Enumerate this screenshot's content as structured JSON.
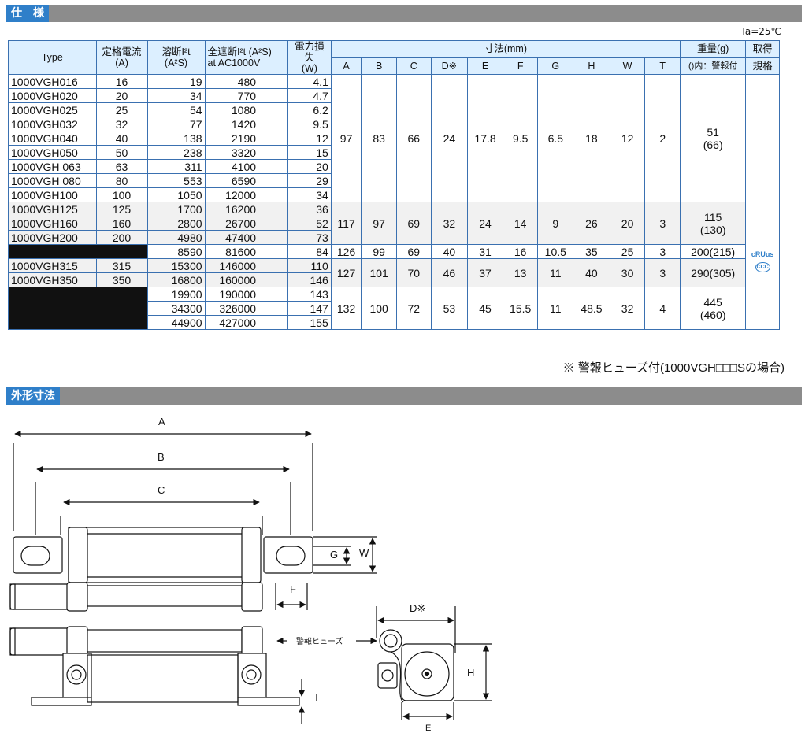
{
  "section1": {
    "title": "仕　様"
  },
  "ta": "Ta=25℃",
  "headers": {
    "type": "Type",
    "rated_current": "定格電流",
    "rated_current_unit": "(A)",
    "melting_i2t": "溶断I²t",
    "melting_i2t_unit": "(A²S)",
    "clearing_i2t": "全遮断I²t (A²S)",
    "clearing_i2t_sub": "at AC1000V",
    "power_loss": "電力損失",
    "power_loss_unit": "(W)",
    "dimensions": "寸法(mm)",
    "dims": [
      "A",
      "B",
      "C",
      "D※",
      "E",
      "F",
      "G",
      "H",
      "W",
      "T"
    ],
    "weight": "重量(g)",
    "weight_sub": "()内：警報付",
    "cert": "取得",
    "cert_sub": "規格"
  },
  "rows": [
    [
      "1000VGH016",
      "16",
      "19",
      "480",
      "4.1"
    ],
    [
      "1000VGH020",
      "20",
      "34",
      "770",
      "4.7"
    ],
    [
      "1000VGH025",
      "25",
      "54",
      "1080",
      "6.2"
    ],
    [
      "1000VGH032",
      "32",
      "77",
      "1420",
      "9.5"
    ],
    [
      "1000VGH040",
      "40",
      "138",
      "2190",
      "12"
    ],
    [
      "1000VGH050",
      "50",
      "238",
      "3320",
      "15"
    ],
    [
      "1000VGH 063",
      "63",
      "311",
      "4100",
      "20"
    ],
    [
      "1000VGH 080",
      "80",
      "553",
      "6590",
      "29"
    ],
    [
      "1000VGH100",
      "100",
      "1050",
      "12000",
      "34"
    ],
    [
      "1000VGH125",
      "125",
      "1700",
      "16200",
      "36"
    ],
    [
      "1000VGH160",
      "160",
      "2800",
      "26700",
      "52"
    ],
    [
      "1000VGH200",
      "200",
      "4980",
      "47400",
      "73"
    ],
    [
      "",
      "",
      "8590",
      "81600",
      "84"
    ],
    [
      "1000VGH315",
      "315",
      "15300",
      "146000",
      "110"
    ],
    [
      "1000VGH350",
      "350",
      "16800",
      "160000",
      "146"
    ],
    [
      "",
      "",
      "19900",
      "190000",
      "143"
    ],
    [
      "",
      "",
      "34300",
      "326000",
      "147"
    ],
    [
      "",
      "",
      "44900",
      "427000",
      "155"
    ]
  ],
  "dim_groups": [
    {
      "dims": [
        "97",
        "83",
        "66",
        "24",
        "17.8",
        "9.5",
        "6.5",
        "18",
        "12",
        "2"
      ],
      "weight": "51",
      "weight_alarm": "(66)"
    },
    {
      "dims": [
        "117",
        "97",
        "69",
        "32",
        "24",
        "14",
        "9",
        "26",
        "20",
        "3"
      ],
      "weight": "115",
      "weight_alarm": "(130)"
    },
    {
      "dims": [
        "126",
        "99",
        "69",
        "40",
        "31",
        "16",
        "10.5",
        "35",
        "25",
        "3"
      ],
      "weight": "200(215)",
      "weight_alarm": ""
    },
    {
      "dims": [
        "127",
        "101",
        "70",
        "46",
        "37",
        "13",
        "11",
        "40",
        "30",
        "3"
      ],
      "weight": "290(305)",
      "weight_alarm": ""
    },
    {
      "dims": [
        "132",
        "100",
        "72",
        "53",
        "45",
        "15.5",
        "11",
        "48.5",
        "32",
        "4"
      ],
      "weight": "445",
      "weight_alarm": "(460)"
    }
  ],
  "cert_marks": {
    "ul": "cRUus",
    "ccc": "CCC"
  },
  "footnote": "※ 警報ヒューズ付(1000VGH□□□Sの場合)",
  "section2": {
    "title": "外形寸法"
  },
  "drawing": {
    "labels": {
      "A": "A",
      "B": "B",
      "C": "C",
      "F": "F",
      "G": "G",
      "W": "W",
      "D": "D※",
      "H": "H",
      "E": "E",
      "T": "T"
    },
    "alarm_fuse": "警報ヒューズ"
  },
  "colors": {
    "accent": "#2f7fc9",
    "header_bg": "#dcefff",
    "border": "#3a70b0",
    "bar": "#8c8c8c"
  }
}
